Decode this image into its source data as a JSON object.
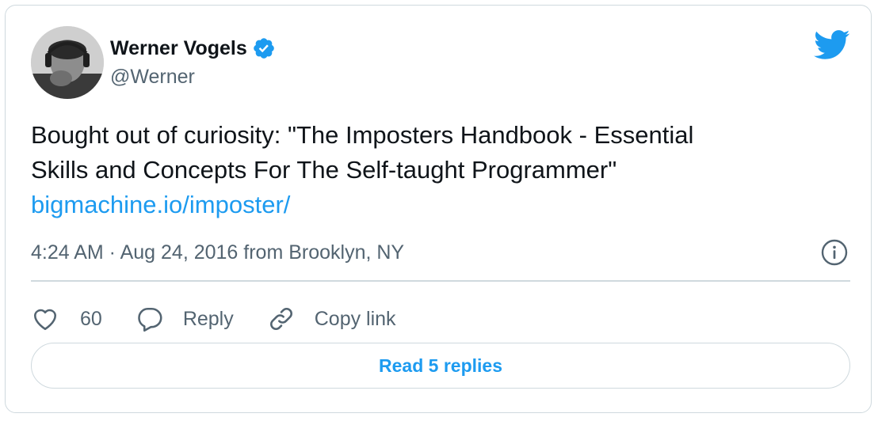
{
  "author": {
    "display_name": "Werner Vogels",
    "handle": "@Werner",
    "verified": true,
    "avatar_icon": "avatar-photo"
  },
  "tweet": {
    "text_line1": "Bought out of curiosity: \"The Imposters Handbook - Essential",
    "text_line2": "Skills and Concepts For The Self-taught Programmer\"",
    "link_text": "bigmachine.io/imposter/",
    "time": "4:24 AM",
    "separator": " · ",
    "date": "Aug 24, 2016",
    "location": " from Brooklyn, NY"
  },
  "actions": {
    "like_count": "60",
    "reply_label": "Reply",
    "copy_link_label": "Copy link"
  },
  "read_replies_label": "Read 5 replies",
  "icons": {
    "brand": "twitter-bird-icon",
    "verified": "verified-badge-icon",
    "info": "info-icon",
    "like": "heart-icon",
    "reply": "speech-bubble-icon",
    "copy": "link-icon"
  },
  "colors": {
    "accent": "#1d9bf0",
    "text": "#0f1419",
    "muted": "#536471",
    "border": "#cfd9de"
  }
}
